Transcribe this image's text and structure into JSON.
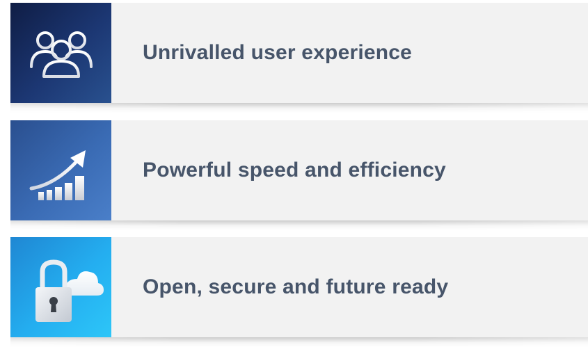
{
  "features": [
    {
      "label": "Unrivalled user experience",
      "icon": "users-icon",
      "tile_color": "#1c3773"
    },
    {
      "label": "Powerful speed and efficiency",
      "icon": "growth-chart-icon",
      "tile_color": "#3a6bb4"
    },
    {
      "label": "Open, secure and future ready",
      "icon": "cloud-lock-icon",
      "tile_color": "#24aef0"
    }
  ],
  "colors": {
    "panel_background": "#f2f2f2",
    "label_text": "#47556a"
  }
}
